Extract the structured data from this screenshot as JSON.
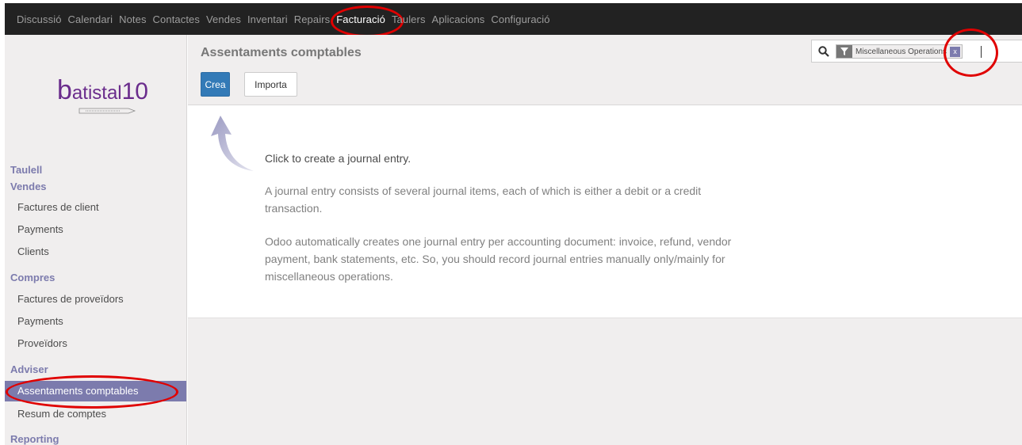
{
  "top_menu": {
    "items": [
      "Discussió",
      "Calendari",
      "Notes",
      "Contactes",
      "Vendes",
      "Inventari",
      "Repairs",
      "Facturació",
      "Taulers",
      "Aplicacions",
      "Configuració"
    ],
    "active": "Facturació"
  },
  "logo": {
    "text_b": "b",
    "text_rest": "atistal",
    "text_num": "10"
  },
  "sidebar": {
    "sections": [
      {
        "title": "Taulell",
        "items": []
      },
      {
        "title": "Vendes",
        "items": [
          "Factures de client",
          "Payments",
          "Clients"
        ]
      },
      {
        "title": "Compres",
        "items": [
          "Factures de proveïdors",
          "Payments",
          "Proveïdors"
        ]
      },
      {
        "title": "Adviser",
        "items": [
          "Assentaments comptables",
          "Resum de comptes"
        ]
      },
      {
        "title": "Reporting",
        "items": []
      }
    ],
    "active_item": "Assentaments comptables"
  },
  "control": {
    "title": "Assentaments comptables",
    "create_label": "Crea",
    "import_label": "Importa"
  },
  "search": {
    "facet_label": "Miscellaneous Operations",
    "facet_remove": "x"
  },
  "help": {
    "headline": "Click to create a journal entry.",
    "para1": "A journal entry consists of several journal items, each of which is either a debit or a credit transaction.",
    "para2": "Odoo automatically creates one journal entry per accounting document: invoice, refund, vendor payment, bank statements, etc. So, you should record journal entries manually only/mainly for miscellaneous operations."
  },
  "colors": {
    "topbar": "#222222",
    "sidebar_bg": "#f0eeee",
    "brand_purple": "#7c7bad",
    "primary_button": "#337ab7",
    "highlight_ring": "#e00000"
  }
}
